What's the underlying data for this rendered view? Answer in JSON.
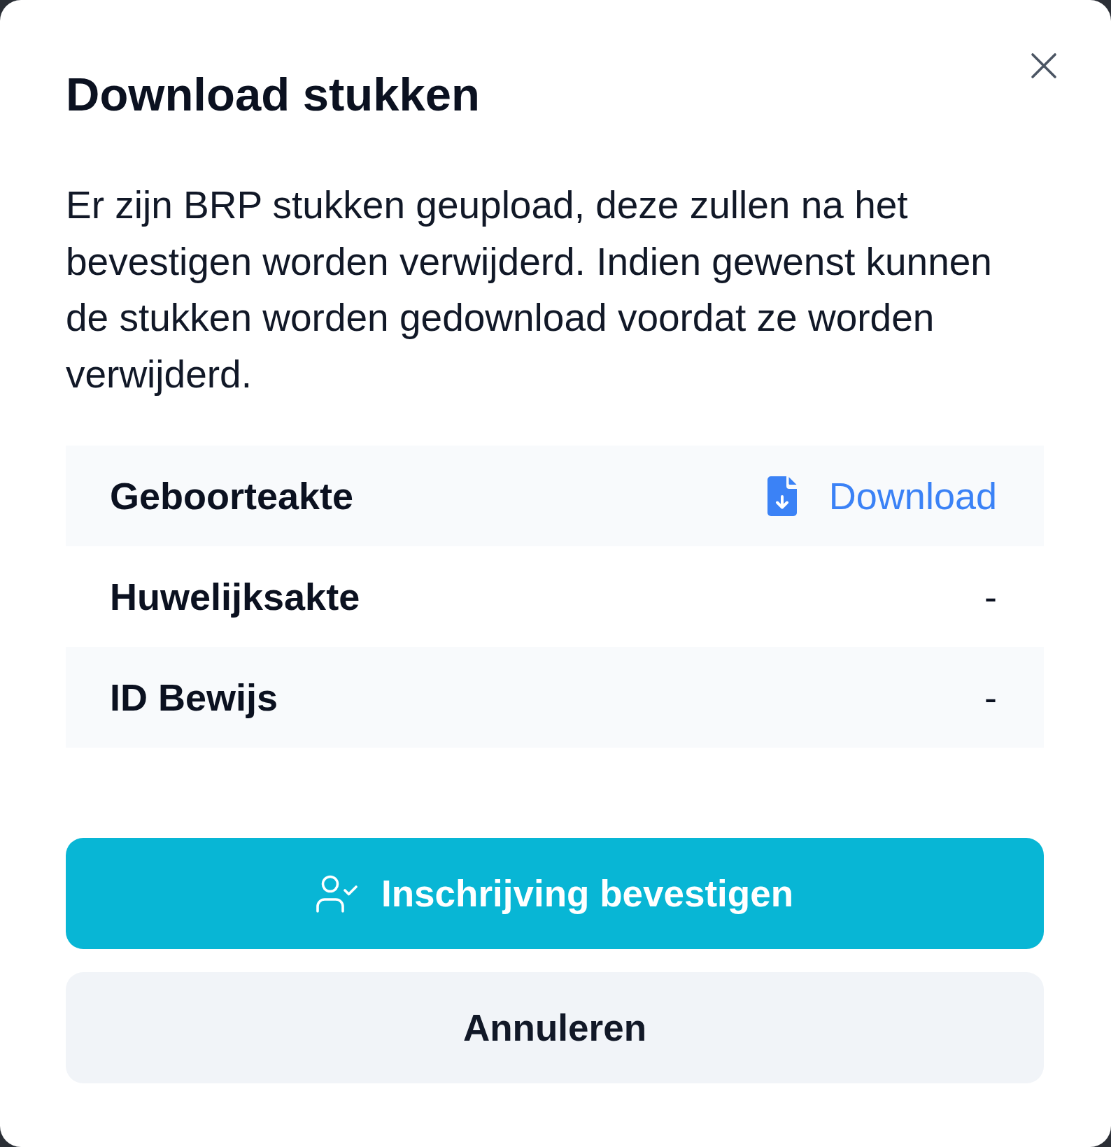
{
  "dialog": {
    "title": "Download stukken",
    "message": "Er zijn BRP stukken geupload, deze zullen na het bevestigen worden verwijderd. Indien gewenst kunnen de stukken worden gedownload voordat ze worden verwijderd.",
    "documents": [
      {
        "name": "Geboorteakte",
        "kind": "download",
        "action": "Download"
      },
      {
        "name": "Huwelijksakte",
        "kind": "none",
        "value": "-"
      },
      {
        "name": "ID Bewijs",
        "kind": "none",
        "value": "-"
      }
    ],
    "buttons": [
      {
        "kind": "confirm",
        "label": "Inschrijving bevestigen"
      },
      {
        "kind": "cancel",
        "label": "Annuleren"
      }
    ]
  }
}
